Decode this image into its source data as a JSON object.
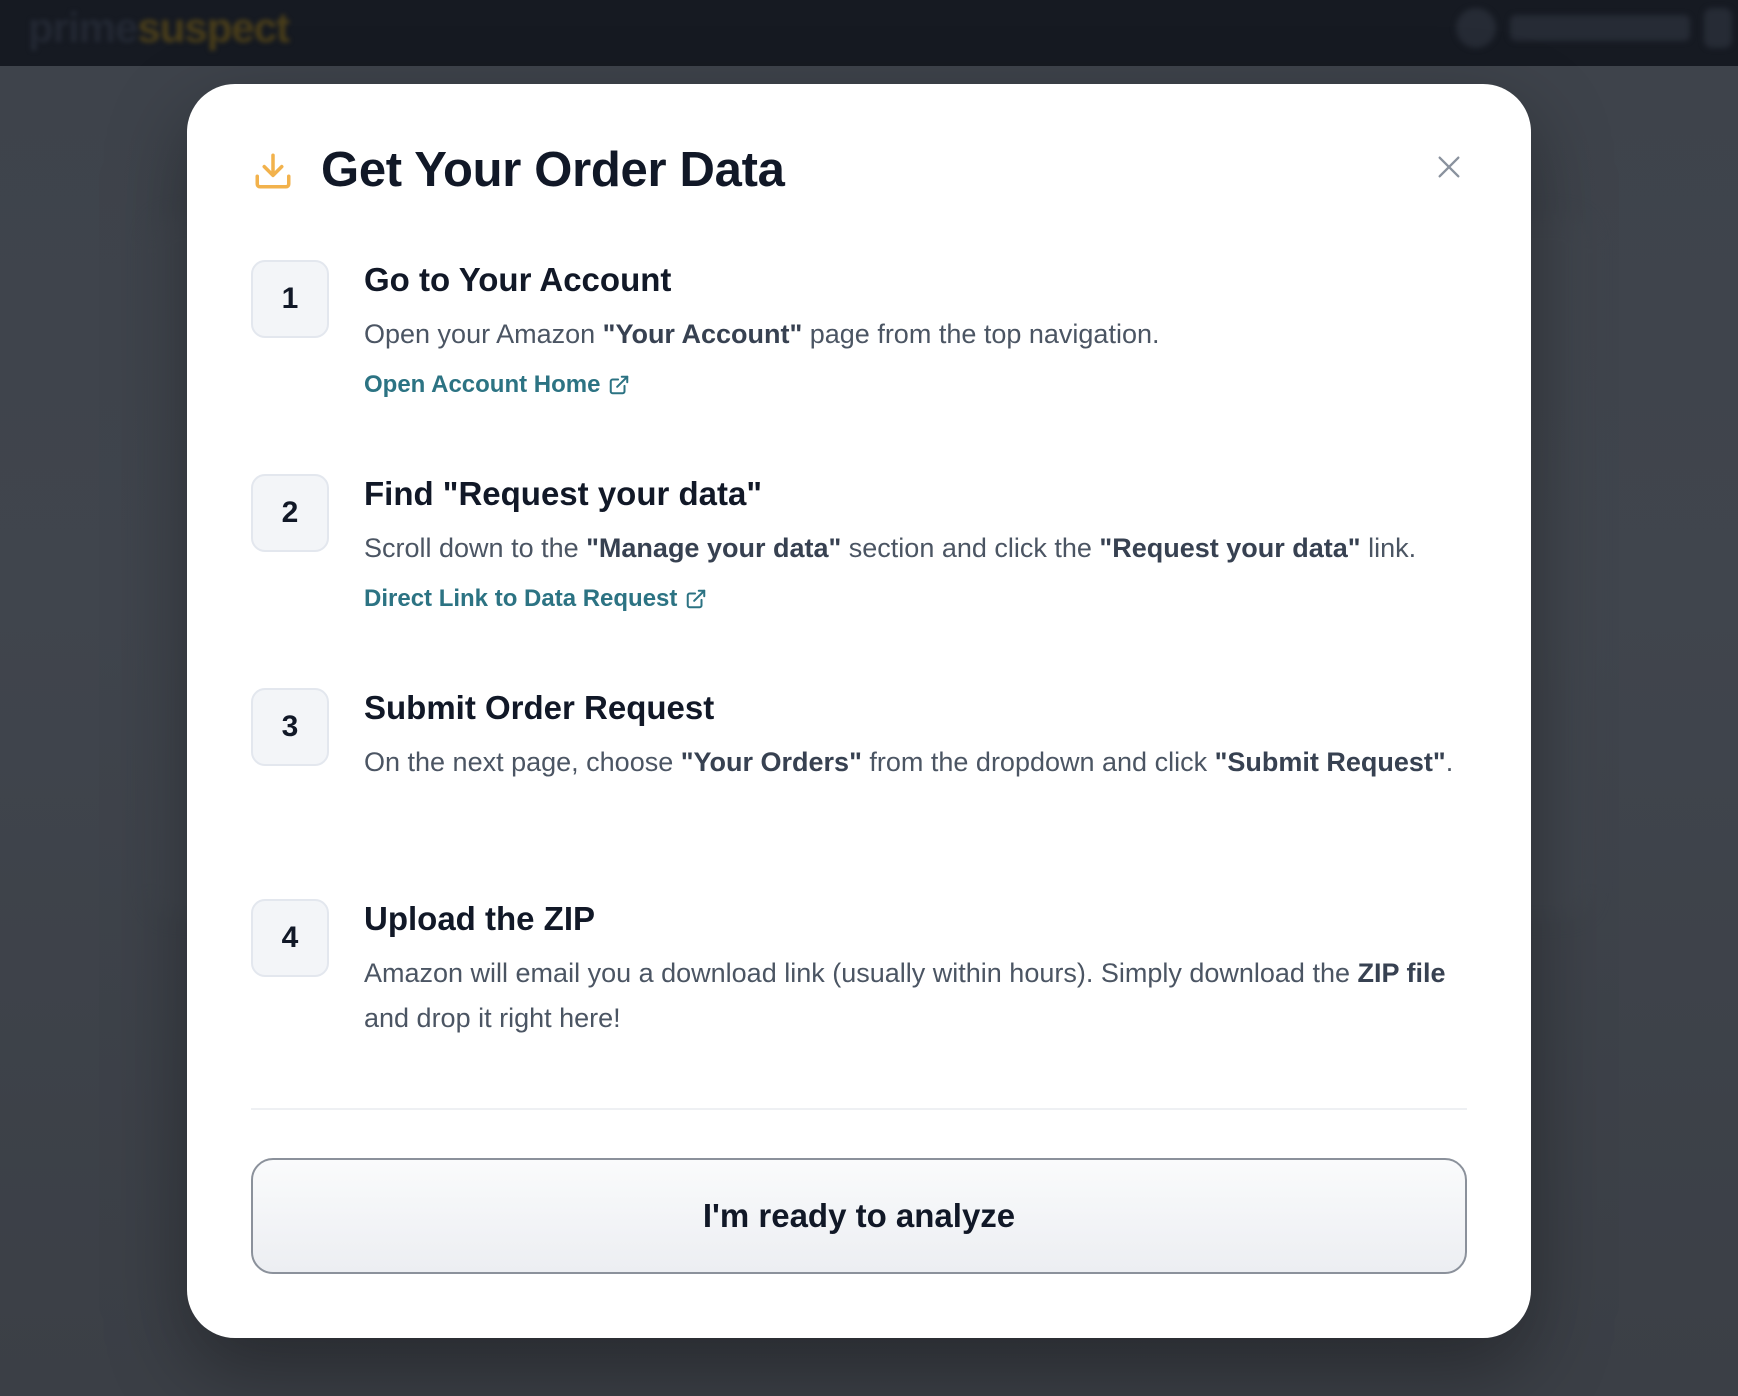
{
  "background": {
    "logo_part1": "prime",
    "logo_part2": "suspect"
  },
  "modal": {
    "title": "Get Your Order Data",
    "title_icon": "download-icon",
    "close_icon": "close-icon",
    "accent_color": "#f2b24c",
    "link_color": "#2c7383",
    "steps": [
      {
        "number": "1",
        "title": "Go to Your Account",
        "desc_parts": [
          "Open your Amazon ",
          "\"Your Account\"",
          " page from the top navigation."
        ],
        "link_label": "Open Account Home",
        "link_icon": "external-link-icon"
      },
      {
        "number": "2",
        "title": "Find \"Request your data\"",
        "desc_parts": [
          "Scroll down to the ",
          "\"Manage your data\"",
          " section and click the ",
          "\"Request your data\"",
          " link."
        ],
        "link_label": "Direct Link to Data Request",
        "link_icon": "external-link-icon"
      },
      {
        "number": "3",
        "title": "Submit Order Request",
        "desc_parts": [
          "On the next page, choose ",
          "\"Your Orders\"",
          " from the dropdown and click ",
          "\"Submit Request\"",
          "."
        ]
      },
      {
        "number": "4",
        "title": "Upload the ZIP",
        "desc_parts": [
          "Amazon will email you a download link (usually within hours). Simply download the ",
          "ZIP file",
          " and drop it right here!"
        ]
      }
    ],
    "primary_button_label": "I'm ready to analyze"
  }
}
